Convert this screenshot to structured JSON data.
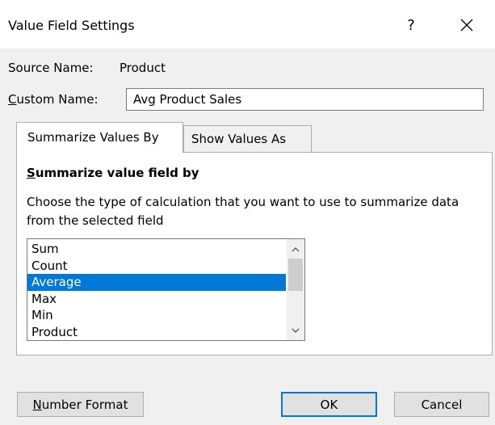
{
  "window": {
    "title": "Value Field Settings",
    "help_label": "?"
  },
  "source": {
    "label": "Source Name:",
    "value": "Product"
  },
  "custom_name": {
    "label_accel": "C",
    "label_rest": "ustom Name:",
    "value": "Avg Product Sales"
  },
  "tabs": [
    {
      "label": "Summarize Values By",
      "active": true
    },
    {
      "label": "Show Values As",
      "active": false
    }
  ],
  "summarize": {
    "section_label_accel": "S",
    "section_label_rest": "ummarize value field by",
    "description": "Choose the type of calculation that you want to use to summarize data from the selected field",
    "items": [
      "Sum",
      "Count",
      "Average",
      "Max",
      "Min",
      "Product"
    ],
    "selected": "Average"
  },
  "buttons": {
    "number_format_accel": "N",
    "number_format_rest": "umber Format",
    "ok": "OK",
    "cancel": "Cancel"
  },
  "colors": {
    "selection": "#0078d7",
    "default_button_border": "#0078d7"
  },
  "icons": {
    "close": "close-icon",
    "scroll_up": "chevron-up-icon",
    "scroll_down": "chevron-down-icon"
  }
}
